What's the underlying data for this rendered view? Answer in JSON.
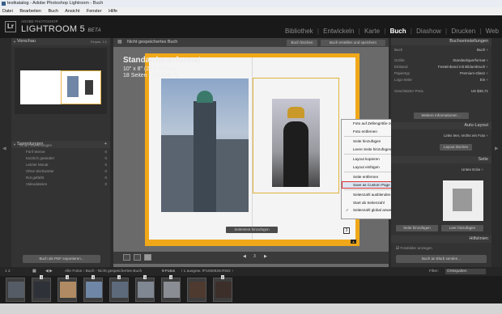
{
  "window": {
    "title": "testkatalog - Adobe Photoshop Lightroom - Buch"
  },
  "menu": [
    "Datei",
    "Bearbeiten",
    "Buch",
    "Ansicht",
    "Fenster",
    "Hilfe"
  ],
  "identity": {
    "logo": "Lr",
    "sub": "ADOBE PHOTOSHOP",
    "product": "LIGHTROOM 5",
    "beta": "BETA"
  },
  "modules": [
    {
      "label": "Bibliothek",
      "active": false
    },
    {
      "label": "Entwickeln",
      "active": false
    },
    {
      "label": "Karte",
      "active": false
    },
    {
      "label": "Buch",
      "active": true
    },
    {
      "label": "Diashow",
      "active": false
    },
    {
      "label": "Drucken",
      "active": false
    },
    {
      "label": "Web",
      "active": false
    }
  ],
  "left": {
    "preview_header": "Vorschau",
    "preview_modes": "Einpas.   1:1",
    "collections_header": "Sammlungen",
    "collections": [
      {
        "label": "Smart-Sammlungen",
        "count": ""
      },
      {
        "label": "Fünf Sterne",
        "count": "0"
      },
      {
        "label": "Kürzlich geändert",
        "count": "0"
      },
      {
        "label": "Letzter Monat",
        "count": "0"
      },
      {
        "label": "Ohne Stichwörter",
        "count": "0"
      },
      {
        "label": "Rot gefärbt",
        "count": "0"
      },
      {
        "label": "Videodateien",
        "count": "0"
      }
    ],
    "export_button": "Buch als PDF exportieren..."
  },
  "center": {
    "toolbar_title": "Nicht gespeichertes Buch",
    "clear_button": "Buch löschen",
    "create_button": "Buch erstellen und speichern",
    "book_title": "Standardquerformat",
    "book_size": "10\" x 8\" (25 x 20 cm)",
    "book_pages": "18 Seiten - US $38,71",
    "add_page_button": "Seitentext hinzufügen",
    "page_number": "3",
    "nav_page": "3"
  },
  "context_menu": {
    "items": [
      {
        "label": "Foto auf Zellengröße zoomen",
        "separator_after": false,
        "highlight": false,
        "check": false
      },
      {
        "label": "Foto entfernen",
        "separator_after": true,
        "highlight": false,
        "check": false
      },
      {
        "label": "Seite hinzufügen",
        "separator_after": false,
        "highlight": false,
        "check": false
      },
      {
        "label": "Leere Seite hinzufügen",
        "separator_after": true,
        "highlight": false,
        "check": false
      },
      {
        "label": "Layout kopieren",
        "separator_after": false,
        "highlight": false,
        "check": false
      },
      {
        "label": "Layout einfügen",
        "separator_after": true,
        "highlight": false,
        "check": false
      },
      {
        "label": "Seite entfernen",
        "separator_after": false,
        "highlight": false,
        "check": false
      },
      {
        "label": "Save as Custom Page",
        "separator_after": true,
        "highlight": true,
        "check": false
      },
      {
        "label": "Seitenzahl ausblenden",
        "separator_after": false,
        "highlight": false,
        "check": false
      },
      {
        "label": "Start ab Seitenzahl",
        "separator_after": false,
        "highlight": false,
        "check": false
      },
      {
        "label": "Seitenzahl global anwenden",
        "separator_after": false,
        "highlight": false,
        "check": true
      }
    ]
  },
  "right": {
    "book_settings_header": "Buchseinstellungen",
    "book_row": {
      "label": "Buch",
      "value": "Buch ÷"
    },
    "settings": [
      {
        "label": "Größe",
        "value": "Standardquerformat ÷"
      },
      {
        "label": "Einband",
        "value": "Festeinband mit Bildumbruch ÷"
      },
      {
        "label": "Papiertyp",
        "value": "Premium-Glanz ÷"
      },
      {
        "label": "Logo-Seite",
        "value": "Ein ÷"
      }
    ],
    "price_label": "Geschätzter Preis",
    "price_value": "US $38,71",
    "more_info": "Weitere Informationen ...",
    "auto_layout_header": "Auto-Layout",
    "auto_layout_value": "Links leer, rechts ein Foto ÷",
    "auto_layout_button": "Layout löschen",
    "page_header": "Seite",
    "page_value": "Unten Ecke ÷",
    "page_num_button": "Seite hinzufügen",
    "blank_button": "Leer hinzufügen",
    "guides_header": "Hilfslinien",
    "text_option": "Fotobilder anzeigen",
    "send_button": "Buch an Blurb senden..."
  },
  "filmstrip": {
    "pages": "1   2",
    "source": "Alle Fotos  ›  Buch - Nicht gespeichertes Buch",
    "count": "9 Fotos",
    "file": "/ 1 ausgew. /P1050929.RW2 ÷",
    "filter_label": "Filter:",
    "filter_value": "Ortsspalten"
  },
  "thumbs": [
    {
      "badge": "",
      "color": "#555c66"
    },
    {
      "badge": "1",
      "color": "#2e3138"
    },
    {
      "badge": "1",
      "color": "#b08a63"
    },
    {
      "badge": "1",
      "color": "#6f86a6"
    },
    {
      "badge": "1",
      "color": "#5c6a7b"
    },
    {
      "badge": "1",
      "color": "#7f8792"
    },
    {
      "badge": "1",
      "color": "#8a8e94"
    },
    {
      "badge": "",
      "color": "#4e3a2e"
    },
    {
      "badge": "2",
      "color": "#3c2f2a"
    }
  ]
}
